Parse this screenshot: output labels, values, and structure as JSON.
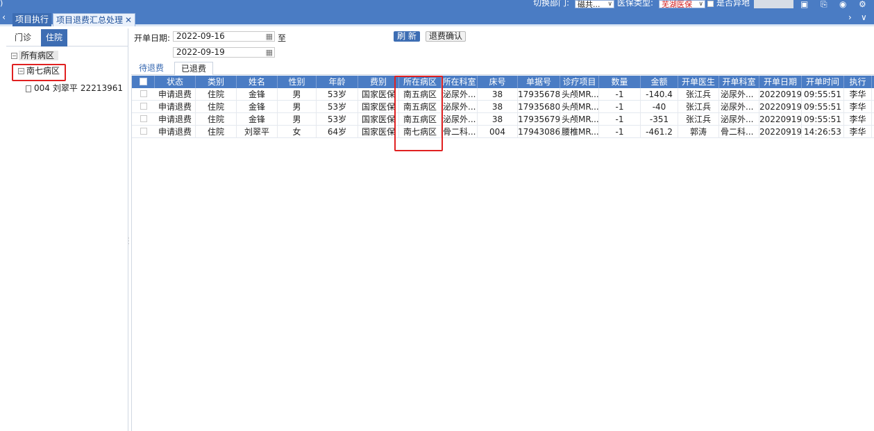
{
  "topbar": {
    "switch_dept_label": "切换部门:",
    "dept_value": "磁共...",
    "insurance_label": "医保类型:",
    "insurance_value": "芜湖医保",
    "insurance_value_color": "#d42020",
    "remote_label": "是否异地",
    "icons": [
      "monitor-icon",
      "export-icon",
      "eye-icon",
      "gear-icon"
    ]
  },
  "tabs": {
    "items": [
      {
        "label": "项目执行"
      },
      {
        "label": "项目退费汇总处理",
        "closable": true
      }
    ],
    "close_glyph": "✕"
  },
  "left_panel": {
    "tabs": [
      "门诊",
      "住院"
    ],
    "active_tab": "住院",
    "tree": {
      "root": "所有病区",
      "node": "南七病区",
      "leaf": {
        "bed": "004",
        "name": "刘翠平",
        "id": "22213961"
      }
    }
  },
  "filter": {
    "date_label": "开单日期:",
    "start_date": "2022-09-16",
    "to_label": "至",
    "end_date": "2022-09-19",
    "refresh_label": "刷 新",
    "confirm_label": "退费确认"
  },
  "sub_tabs": [
    "待退费",
    "已退费"
  ],
  "table": {
    "columns": [
      "状态",
      "类别",
      "姓名",
      "性别",
      "年龄",
      "费别",
      "所在病区",
      "所在科室",
      "床号",
      "单据号",
      "诊疗项目",
      "数量",
      "金额",
      "开单医生",
      "开单科室",
      "开单日期",
      "开单时间",
      "执行"
    ],
    "rows": [
      [
        "申请退费",
        "住院",
        "金锋",
        "男",
        "53岁",
        "国家医保",
        "南五病区",
        "泌尿外...",
        "38",
        "17935678",
        "头颅MR...",
        "-1",
        "-140.4",
        "张江兵",
        "泌尿外...",
        "20220919",
        "09:55:51",
        "李华"
      ],
      [
        "申请退费",
        "住院",
        "金锋",
        "男",
        "53岁",
        "国家医保",
        "南五病区",
        "泌尿外...",
        "38",
        "17935680",
        "头颅MR...",
        "-1",
        "-40",
        "张江兵",
        "泌尿外...",
        "20220919",
        "09:55:51",
        "李华"
      ],
      [
        "申请退费",
        "住院",
        "金锋",
        "男",
        "53岁",
        "国家医保",
        "南五病区",
        "泌尿外...",
        "38",
        "17935679",
        "头颅MR...",
        "-1",
        "-351",
        "张江兵",
        "泌尿外...",
        "20220919",
        "09:55:51",
        "李华"
      ],
      [
        "申请退费",
        "住院",
        "刘翠平",
        "女",
        "64岁",
        "国家医保",
        "南七病区",
        "骨二科...",
        "004",
        "17943086",
        "腰椎MR...",
        "-1",
        "-461.2",
        "郭涛",
        "骨二科...",
        "20220919",
        "14:26:53",
        "李华"
      ]
    ]
  },
  "colors": {
    "header_blue": "#4a7cc4",
    "highlight_red": "#e02020"
  }
}
